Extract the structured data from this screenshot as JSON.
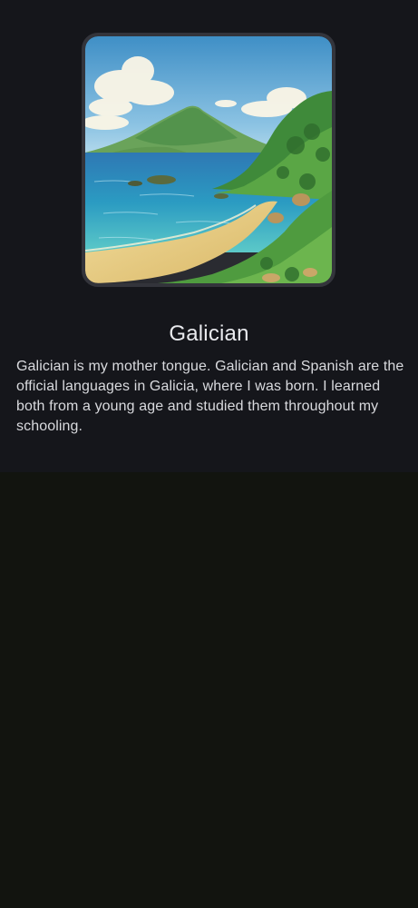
{
  "card": {
    "image_description": "watercolor coastal landscape",
    "title": "Galician",
    "description": "Galician is my mother tongue. Galician and Spanish are the official languages in Galicia, where I was born. I learned both from a young age and studied them throughout my schooling."
  },
  "colors": {
    "panel_background": "#15161b",
    "page_background": "#12140f",
    "frame_border": "#33343b",
    "title_text": "#e9eaee",
    "body_text": "#d9dade"
  }
}
